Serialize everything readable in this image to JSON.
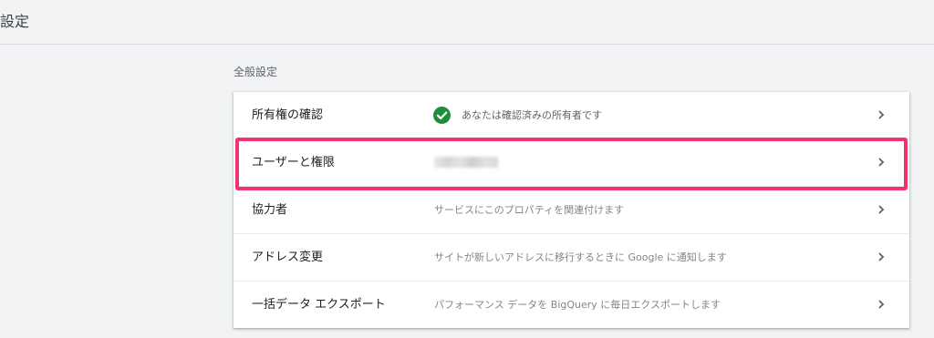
{
  "header": {
    "title": "設定"
  },
  "section": {
    "title": "全般設定"
  },
  "rows": [
    {
      "label": "所有権の確認",
      "description": "あなたは確認済みの所有者です",
      "icon": "check-circle-icon"
    },
    {
      "label": "ユーザーと権限",
      "description": ""
    },
    {
      "label": "協力者",
      "description": "サービスにこのプロパティを関連付けます"
    },
    {
      "label": "アドレス変更",
      "description": "サイトが新しいアドレスに移行するときに Google に通知します"
    },
    {
      "label": "一括データ エクスポート",
      "description": "パフォーマンス データを BigQuery に毎日エクスポートします"
    }
  ],
  "colors": {
    "highlight": "#f0336b",
    "check": "#1e8e3e",
    "background": "#f1f3f4"
  }
}
